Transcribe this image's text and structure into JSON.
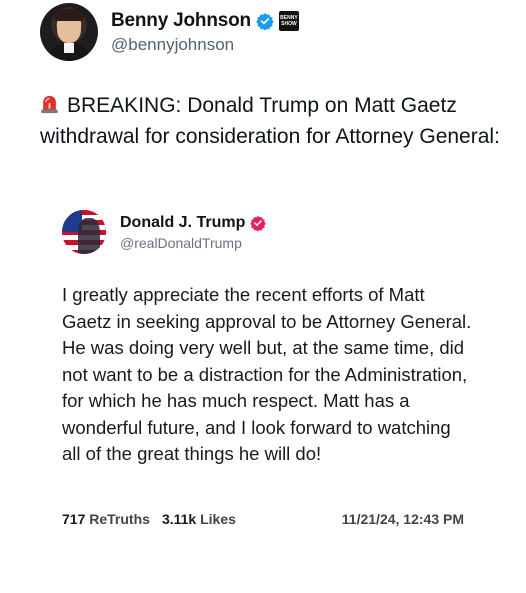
{
  "author": {
    "name": "Benny Johnson",
    "handle": "@bennyjohnson",
    "badge_text": "BENNY SHOW",
    "verified_color": "#1d9bf0"
  },
  "post": {
    "icon": "siren-icon",
    "text": "BREAKING: Donald Trump on Matt Gaetz withdrawal for consideration for Attorney General:"
  },
  "quoted_truth": {
    "name": "Donald J. Trump",
    "handle": "@realDonaldTrump",
    "verified_color": "#e0245e",
    "body": "I greatly appreciate the recent efforts of Matt Gaetz in seeking approval to be Attorney General. He was doing very well but, at the same time, did not want to be a distraction for the Administration, for which he has much respect. Matt has a wonderful future, and I look forward to watching all of the great things he will do!",
    "retruths_count": "717",
    "retruths_label": "ReTruths",
    "likes_count": "3.11k",
    "likes_label": "Likes",
    "timestamp": "11/21/24, 12:43 PM"
  }
}
